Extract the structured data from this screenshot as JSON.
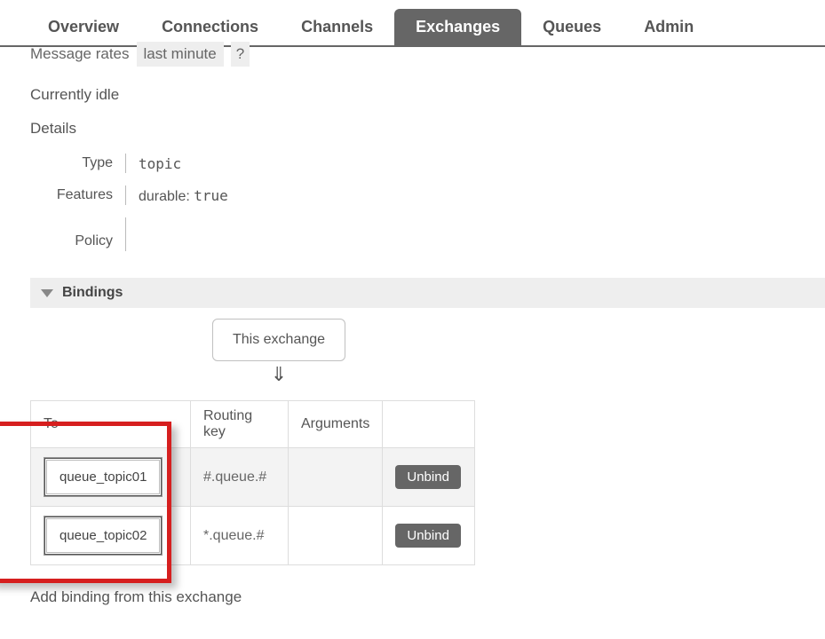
{
  "tabs": {
    "overview": "Overview",
    "connections": "Connections",
    "channels": "Channels",
    "exchanges": "Exchanges",
    "queues": "Queues",
    "admin": "Admin",
    "active": "exchanges"
  },
  "rates": {
    "label": "Message rates",
    "select": "last minute",
    "qmark": "?"
  },
  "idle": "Currently idle",
  "details_header": "Details",
  "details": {
    "type_label": "Type",
    "type_value": "topic",
    "features_label": "Features",
    "features_key": "durable:",
    "features_value": "true",
    "policy_label": "Policy",
    "policy_value": ""
  },
  "bindings_header": "Bindings",
  "this_exchange": "This exchange",
  "arrow": "⇓",
  "bind_table": {
    "headers": {
      "to": "To",
      "routing": "Routing key",
      "args": "Arguments"
    },
    "rows": [
      {
        "to": "queue_topic01",
        "routing": "#.queue.#",
        "args": "",
        "unbind": "Unbind"
      },
      {
        "to": "queue_topic02",
        "routing": "*.queue.#",
        "args": "",
        "unbind": "Unbind"
      }
    ]
  },
  "add_binding": "Add binding from this exchange"
}
